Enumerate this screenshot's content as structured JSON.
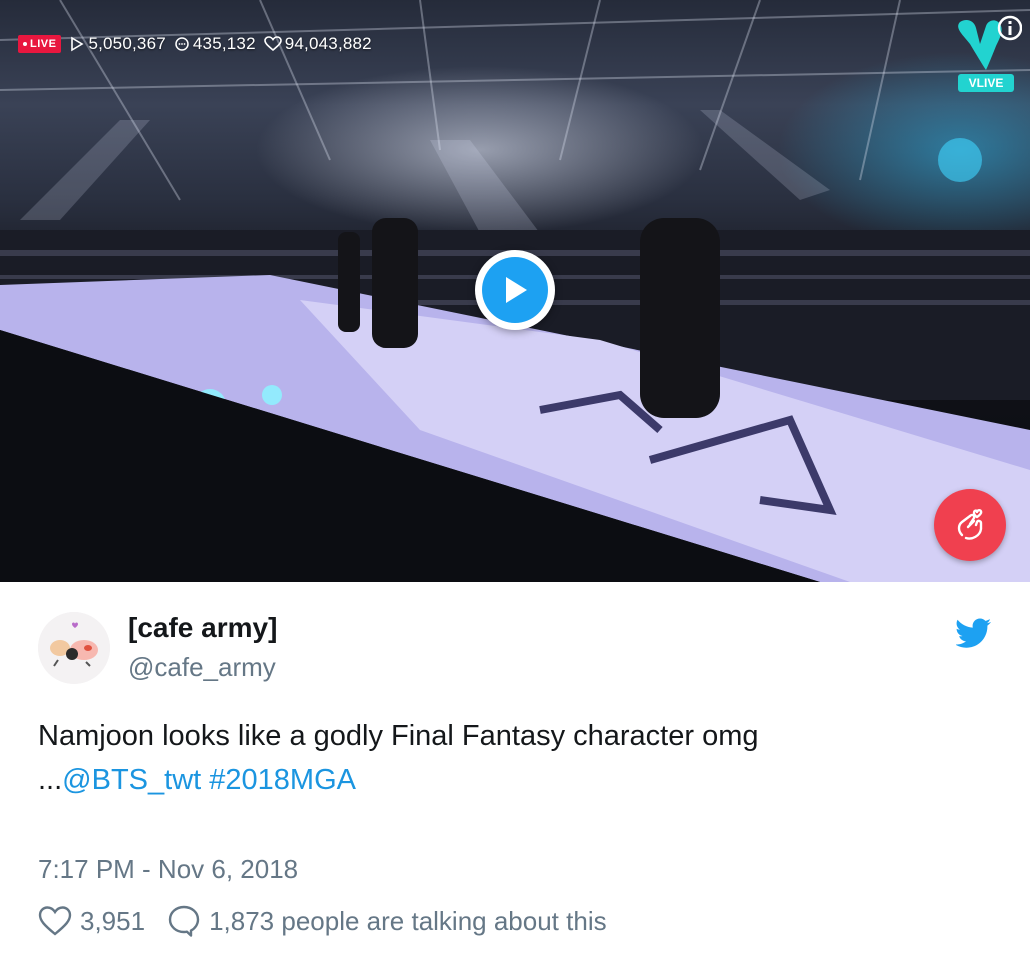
{
  "video": {
    "live_label": "LIVE",
    "views": "5,050,367",
    "comments": "435,132",
    "hearts": "94,043,882",
    "brand_label": "VLIVE",
    "play_icon": "play-icon",
    "heart_gesture_icon": "finger-heart-icon",
    "colors": {
      "live": "#e8173f",
      "play": "#1da1f2",
      "heart_button": "#f0404f",
      "vlive": "#22d3d0"
    }
  },
  "tweet": {
    "display_name": "[cafe army]",
    "handle": "@cafe_army",
    "text_main": "Namjoon looks like a godly Final Fantasy character omg",
    "text_ellipsis": "...",
    "mention": "@BTS_twt",
    "hashtag": "#2018MGA",
    "timestamp": "7:17 PM - Nov 6, 2018",
    "likes": "3,951",
    "talking": "1,873 people are talking about this",
    "colors": {
      "text": "#14171a",
      "muted": "#657786",
      "link": "#1b95e0",
      "brand": "#1da1f2"
    }
  }
}
